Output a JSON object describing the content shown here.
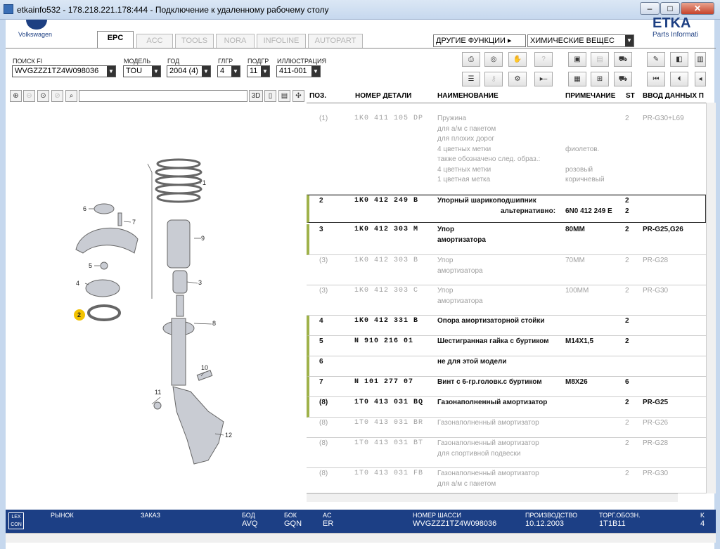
{
  "window": {
    "title": "etkainfo532 - 178.218.221.178:444 - Подключение к удаленному рабочему столу",
    "minimize": "–",
    "maximize": "□",
    "close": "✕"
  },
  "brand": {
    "vw_label": "Volkswagen",
    "etka_title": "ETKA",
    "etka_sub": "Parts Informati"
  },
  "tabs": [
    {
      "label": "EPC",
      "active": true
    },
    {
      "label": "ACC",
      "active": false
    },
    {
      "label": "TOOLS",
      "active": false
    },
    {
      "label": "NORA",
      "active": false
    },
    {
      "label": "INFOLINE",
      "active": false
    },
    {
      "label": "AUTOPART",
      "active": false
    }
  ],
  "functions": {
    "other_label": "ДРУГИЕ ФУНКЦИИ ▸",
    "chem_value": "ХИМИЧЕСКИЕ ВЕЩЕС"
  },
  "filters": [
    {
      "label": "ПОИСК FI",
      "value": "WVGZZZ1TZ4W098036"
    },
    {
      "label": "МОДЕЛЬ",
      "value": "TOU"
    },
    {
      "label": "ГОД",
      "value": "2004 (4)"
    },
    {
      "label": "ГЛГР",
      "value": "4"
    },
    {
      "label": "ПОДГР",
      "value": "11"
    },
    {
      "label": "ИЛЛЮСТРАЦИЯ",
      "value": "411-001"
    }
  ],
  "toolbar_icons": {
    "mode_3d": "3D"
  },
  "table": {
    "headers": [
      "ПОЗ.",
      "НОМЕР ДЕТАЛИ",
      "НАИМЕНОВАНИЕ",
      "ПРИМЕЧАНИЕ",
      "ST",
      "ВВОД ДАННЫХ П"
    ],
    "rows": [
      {
        "pos": "(1)",
        "part": "1K0  411  105  DP",
        "name": [
          "Пружина",
          "для а/м с пакетом",
          "для плохих дорог",
          "4 цветных метки",
          "также обозначено след. образ.:",
          "4 цветных метки",
          "1 цветная метка"
        ],
        "note": [
          "",
          "",
          "",
          "фиолетов.",
          "",
          "розовый",
          "коричневый"
        ],
        "st": "2",
        "data": "PR-G30+L69",
        "style": "gray"
      },
      {
        "pos": "2",
        "part": "1K0  412  249  B",
        "name": [
          "Упорный шарикоподшипник"
        ],
        "alt_label": "альтернативно:",
        "note": [
          "",
          "6N0 412 249 E"
        ],
        "st": "2",
        "st2": "2",
        "data": "",
        "style": "boxed"
      },
      {
        "pos": "3",
        "part": "1K0  412  303  M",
        "name": [
          "Упор",
          "амортизатора"
        ],
        "note": [
          "80MM"
        ],
        "st": "2",
        "data": "PR-G25,G26",
        "style": "mark"
      },
      {
        "pos": "(3)",
        "part": "1K0  412  303  B",
        "name": [
          "Упор",
          "амортизатора"
        ],
        "note": [
          "70MM"
        ],
        "st": "2",
        "data": "PR-G28",
        "style": "gray"
      },
      {
        "pos": "(3)",
        "part": "1K0  412  303  C",
        "name": [
          "Упор",
          "амортизатора"
        ],
        "note": [
          "100MM"
        ],
        "st": "2",
        "data": "PR-G30",
        "style": "gray"
      },
      {
        "pos": "4",
        "part": "1K0  412  331  B",
        "name": [
          "Опора амортизаторной стойки"
        ],
        "note": [
          ""
        ],
        "st": "2",
        "data": "",
        "style": "mark"
      },
      {
        "pos": "5",
        "part": "N    910  216  01",
        "name": [
          "Шестигранная гайка с буртиком"
        ],
        "note": [
          "M14X1,5"
        ],
        "st": "2",
        "data": "",
        "style": "mark"
      },
      {
        "pos": "6",
        "part": "",
        "name": [
          "не для этой модели"
        ],
        "note": [
          ""
        ],
        "st": "",
        "data": "",
        "style": "mark"
      },
      {
        "pos": "7",
        "part": "N    101  277  07",
        "name": [
          "Винт с 6-гр.головк.с буртиком"
        ],
        "note": [
          "M8X26"
        ],
        "st": "6",
        "data": "",
        "style": "mark"
      },
      {
        "pos": "(8)",
        "part": "1T0  413  031  BQ",
        "name": [
          "Газонаполненный амортизатор"
        ],
        "note": [
          ""
        ],
        "st": "2",
        "data": "PR-G25",
        "style": "mark"
      },
      {
        "pos": "(8)",
        "part": "1T0  413  031  BR",
        "name": [
          "Газонаполненный амортизатор"
        ],
        "note": [
          ""
        ],
        "st": "2",
        "data": "PR-G26",
        "style": "gray"
      },
      {
        "pos": "(8)",
        "part": "1T0  413  031  BT",
        "name": [
          "Газонаполненный амортизатор",
          "для спортивной подвески"
        ],
        "note": [
          ""
        ],
        "st": "2",
        "data": "PR-G28",
        "style": "gray"
      },
      {
        "pos": "(8)",
        "part": "1T0  413  031  FB",
        "name": [
          "Газонаполненный амортизатор",
          "для а/м с пакетом"
        ],
        "note": [
          ""
        ],
        "st": "2",
        "data": "PR-G30",
        "style": "gray"
      }
    ]
  },
  "diagram": {
    "callouts": [
      "1",
      "9",
      "3",
      "8",
      "10",
      "11",
      "12",
      "6",
      "7",
      "5",
      "4",
      "2"
    ],
    "highlighted": "2"
  },
  "status": {
    "logo": "LEX CON",
    "fields": [
      {
        "label": "РЫНОК",
        "value": ""
      },
      {
        "label": "ЗАКАЗ",
        "value": ""
      },
      {
        "label": "БОД",
        "value": "AVQ"
      },
      {
        "label": "БОК",
        "value": "GQN"
      },
      {
        "label": "AC",
        "value": "ER"
      },
      {
        "label": "НОМЕР ШАССИ",
        "value": "WVGZZZ1TZ4W098036"
      },
      {
        "label": "ПРОИЗВОДСТВО",
        "value": "10.12.2003"
      },
      {
        "label": "ТОРГ.ОБОЗН.",
        "value": "1T1B11"
      },
      {
        "label": "K",
        "value": "4"
      }
    ]
  },
  "colors": {
    "status_bg": "#1c3f85",
    "row_mark": "#9fb24a",
    "callout_highlight": "#f2c200"
  }
}
